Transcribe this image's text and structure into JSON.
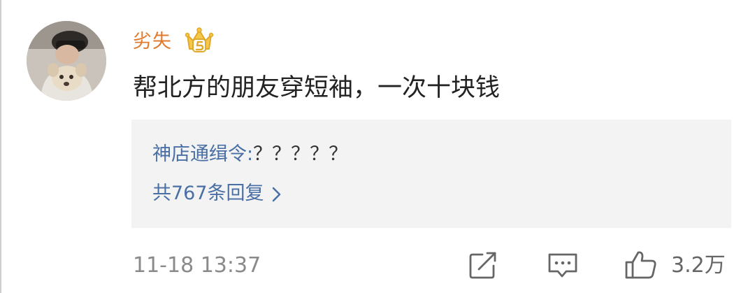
{
  "comment": {
    "username": "劣失",
    "text": "帮北方的朋友穿短袖，一次十块钱",
    "vip_badge_icon": "crown-vip-icon",
    "timestamp": "11-18 13:37",
    "like_count": "3.2万"
  },
  "reply_preview": {
    "author": "神店通缉令",
    "separator": ":",
    "text": "？？？？？",
    "count_label": "共767条回复"
  },
  "actions": {
    "share_icon": "share-icon",
    "comment_icon": "comment-icon",
    "like_icon": "thumbs-up-icon"
  },
  "colors": {
    "username": "#e07a2c",
    "link": "#4a6fa5",
    "reply_background": "#f3f3f3",
    "meta": "#8a8a8a"
  }
}
